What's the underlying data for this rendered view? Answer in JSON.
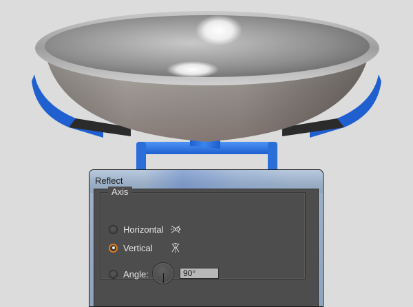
{
  "dialog": {
    "title": "Reflect",
    "axis_legend": "Axis",
    "options": {
      "horizontal": {
        "label": "Horizontal",
        "selected": false,
        "icon": "reflect-horizontal-icon"
      },
      "vertical": {
        "label": "Vertical",
        "selected": true,
        "icon": "reflect-vertical-icon"
      },
      "angle": {
        "label": "Angle:",
        "selected": false,
        "value": "90°"
      }
    }
  },
  "colors": {
    "canvas_bg": "#dcdcdc",
    "scale_blue": "#2a6fd8",
    "bowl_silver": "#b0b0b0",
    "bowl_body": "#a39e98",
    "dialog_panel": "#4d4d4d",
    "radio_selected": "#e07b1a"
  }
}
